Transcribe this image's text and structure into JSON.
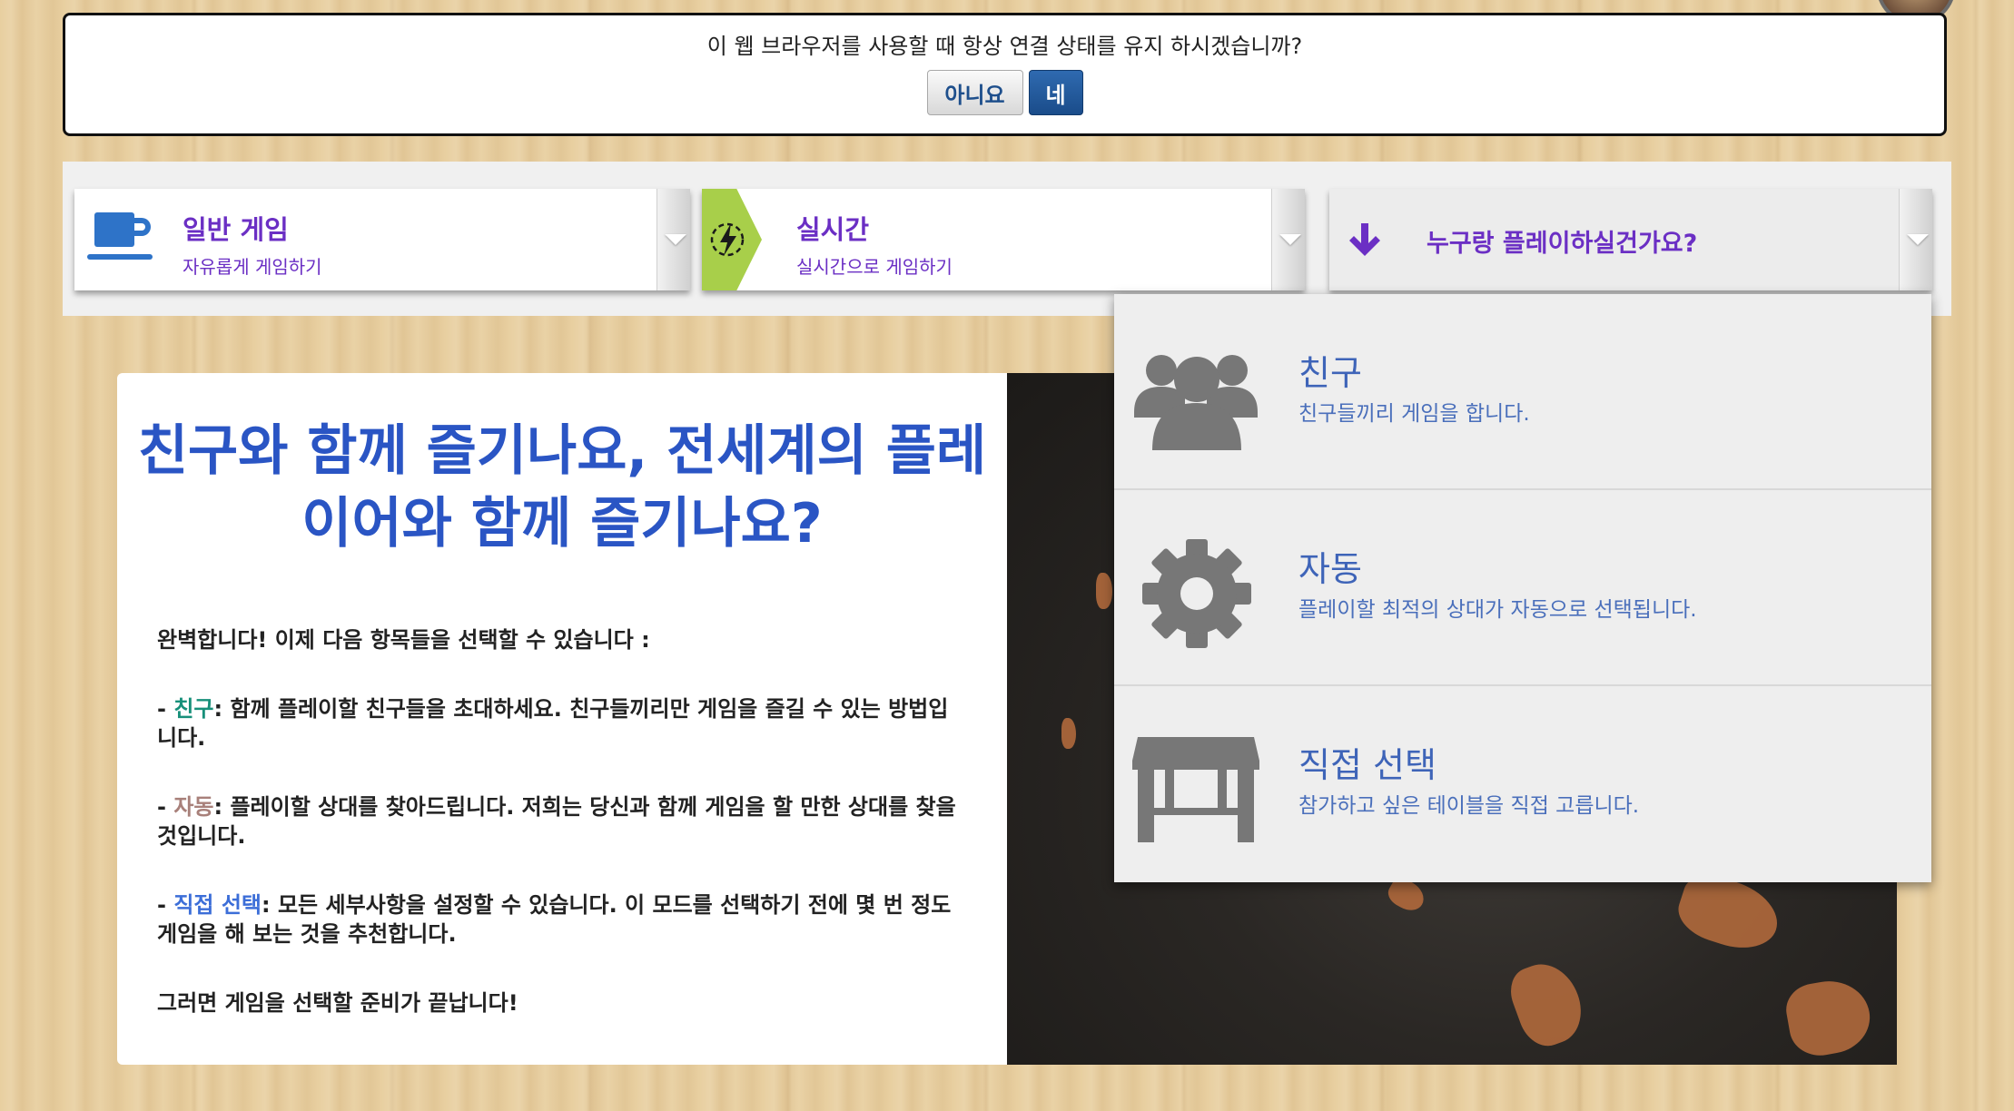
{
  "banner": {
    "question": "이 웹 브라우저를 사용할 때 항상 연결 상태를 유지 하시겠습니까?",
    "no_label": "아니요",
    "yes_label": "네"
  },
  "modes": [
    {
      "title": "일반 게임",
      "subtitle": "자유롭게 게임하기",
      "icon": "coffee-cup-icon"
    },
    {
      "title": "실시간",
      "subtitle": "실시간으로 게임하기",
      "icon": "lightning-icon"
    },
    {
      "title": "누구랑 플레이하실건가요?",
      "icon": "arrow-down-icon"
    }
  ],
  "info": {
    "title": "친구와 함께 즐기나요, 전세계의 플레이어와 함께 즐기나요?",
    "intro": "완벽합니다! 이제 다음 항목들을 선택할 수 있습니다 :",
    "friend_prefix": "- ",
    "friend_kw": "친구",
    "friend_text": ": 함께 플레이할 친구들을 초대하세요. 친구들끼리만 게임을 즐길 수 있는 방법입니다.",
    "auto_prefix": "- ",
    "auto_kw": "자동",
    "auto_text": ": 플레이할 상대를 찾아드립니다. 저희는 당신과 함께 게임을 할 만한 상대를 찾을 것입니다.",
    "manual_prefix": "- ",
    "manual_kw": "직접 선택",
    "manual_text": ": 모든 세부사항을 설정할 수 있습니다. 이 모드를 선택하기 전에 몇 번 정도 게임을 해 보는 것을 추천합니다.",
    "outro": "그러면 게임을 선택할 준비가 끝납니다!"
  },
  "menu": [
    {
      "title": "친구",
      "desc": "친구들끼리 게임을 합니다.",
      "icon": "group-icon"
    },
    {
      "title": "자동",
      "desc": "플레이할 최적의 상대가 자동으로 선택됩니다.",
      "icon": "gear-icon"
    },
    {
      "title": "직접 선택",
      "desc": "참가하고 싶은 테이블을 직접 고릅니다.",
      "icon": "table-icon"
    }
  ],
  "colors": {
    "accent_purple": "#6b2fc4",
    "title_blue": "#2a55c4",
    "friend_green": "#17907a",
    "auto_brown": "#a8807a",
    "manual_blue": "#3c6ed8",
    "lightning_green": "#a8cf4a"
  }
}
